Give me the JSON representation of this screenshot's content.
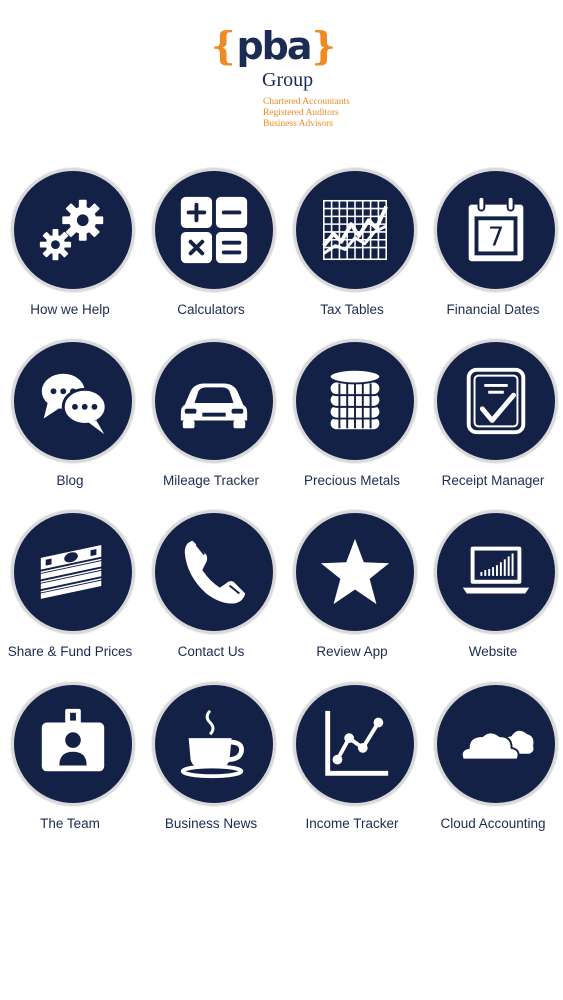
{
  "logo": {
    "brace_open": "{",
    "word": "pba",
    "brace_close": "}",
    "group": "Group",
    "tagline": [
      "Chartered Accountants",
      "Registered Auditors",
      "Business Advisors"
    ]
  },
  "colors": {
    "navy": "#142147",
    "text": "#1c2b52",
    "accent": "#f08a24"
  },
  "tiles": [
    {
      "label": "How we Help",
      "icon": "gears-icon"
    },
    {
      "label": "Calculators",
      "icon": "calculator-icon"
    },
    {
      "label": "Tax Tables",
      "icon": "chart-grid-icon"
    },
    {
      "label": "Financial Dates",
      "icon": "calendar-icon"
    },
    {
      "label": "Blog",
      "icon": "chat-bubbles-icon"
    },
    {
      "label": "Mileage Tracker",
      "icon": "car-icon"
    },
    {
      "label": "Precious Metals",
      "icon": "coin-stack-icon"
    },
    {
      "label": "Receipt Manager",
      "icon": "receipt-check-icon"
    },
    {
      "label": "Share & Fund Prices",
      "icon": "money-stack-icon"
    },
    {
      "label": "Contact Us",
      "icon": "phone-icon"
    },
    {
      "label": "Review App",
      "icon": "star-icon"
    },
    {
      "label": "Website",
      "icon": "laptop-icon"
    },
    {
      "label": "The Team",
      "icon": "id-badge-icon"
    },
    {
      "label": "Business News",
      "icon": "coffee-cup-icon"
    },
    {
      "label": "Income Tracker",
      "icon": "line-chart-icon"
    },
    {
      "label": "Cloud Accounting",
      "icon": "cloud-icon"
    }
  ],
  "calendar": {
    "day": "7"
  }
}
